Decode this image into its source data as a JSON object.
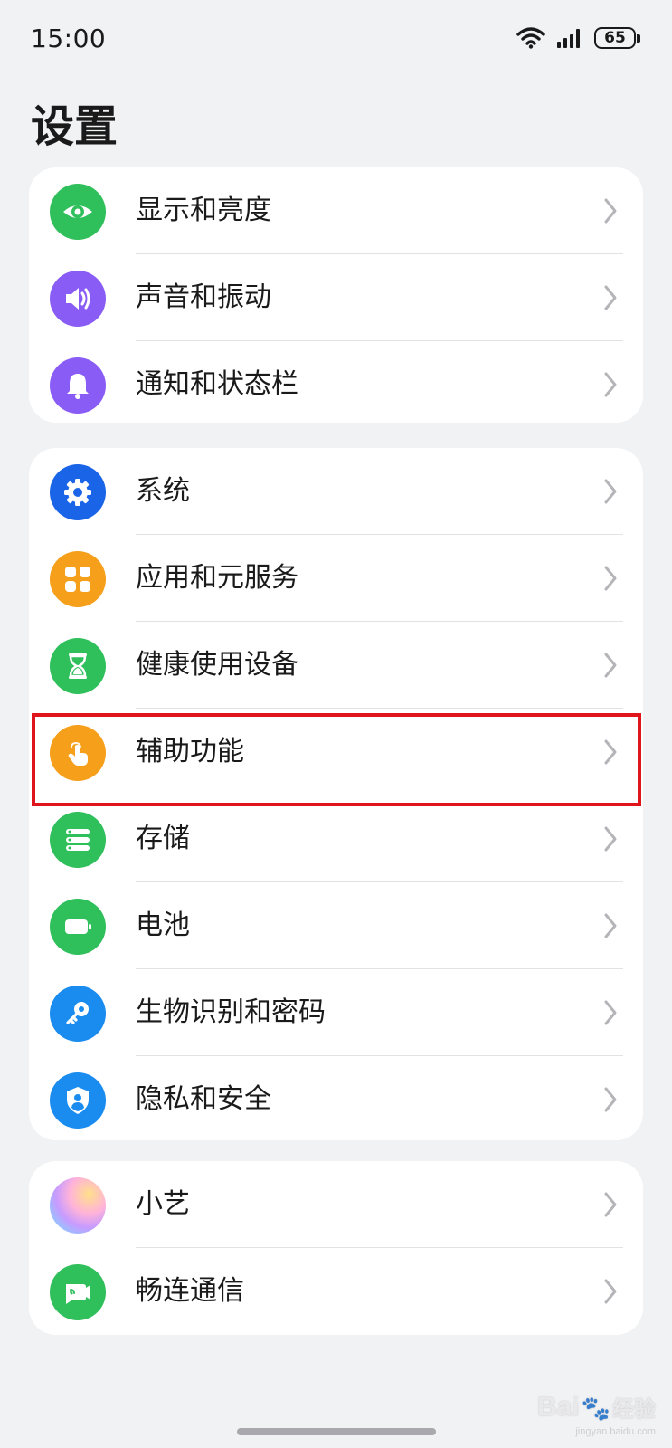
{
  "status_bar": {
    "time": "15:00",
    "battery_level": "65",
    "icons": [
      "wifi-icon",
      "signal-icon",
      "battery-icon"
    ]
  },
  "page": {
    "title": "设置"
  },
  "groups": [
    {
      "items": [
        {
          "label": "显示和亮度",
          "icon": "eye-icon",
          "color": "#2fbf5b"
        },
        {
          "label": "声音和振动",
          "icon": "speaker-icon",
          "color": "#8a5cf6"
        },
        {
          "label": "通知和状态栏",
          "icon": "bell-icon",
          "color": "#8a5cf6"
        }
      ]
    },
    {
      "items": [
        {
          "label": "系统",
          "icon": "gear-icon",
          "color": "#1a64e8"
        },
        {
          "label": "应用和元服务",
          "icon": "apps-grid-icon",
          "color": "#f59f1a"
        },
        {
          "label": "健康使用设备",
          "icon": "hourglass-icon",
          "color": "#2fbf5b"
        },
        {
          "label": "辅助功能",
          "icon": "hand-pointer-icon",
          "color": "#f59f1a"
        },
        {
          "label": "存储",
          "icon": "storage-icon",
          "color": "#2fbf5b"
        },
        {
          "label": "电池",
          "icon": "battery-icon",
          "color": "#2fbf5b"
        },
        {
          "label": "生物识别和密码",
          "icon": "key-icon",
          "color": "#1a8cf0"
        },
        {
          "label": "隐私和安全",
          "icon": "shield-user-icon",
          "color": "#1a8cf0"
        }
      ]
    },
    {
      "items": [
        {
          "label": "小艺",
          "icon": "xiaoyi-orb-icon",
          "color": "#f4a6d6"
        },
        {
          "label": "畅连通信",
          "icon": "video-call-icon",
          "color": "#2fbf5b"
        }
      ]
    }
  ],
  "highlighted_item": "辅助功能",
  "watermark": {
    "brand": "Bai",
    "brand2": "经验",
    "url": "jingyan.baidu.com"
  }
}
